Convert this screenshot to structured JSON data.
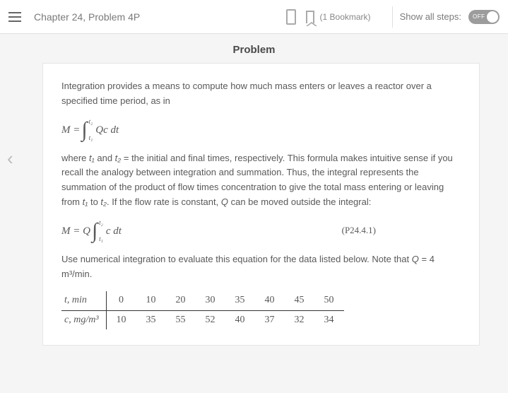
{
  "header": {
    "title": "Chapter 24, Problem 4P",
    "bookmark_text": "(1 Bookmark)",
    "steps_label": "Show all steps:",
    "toggle_state": "OFF"
  },
  "section_heading": "Problem",
  "para1": "Integration provides a means to compute how much mass enters or leaves a reactor over a specified time period, as in",
  "eq1": {
    "lhs": "M =",
    "upper": "t₂",
    "lower": "t₁",
    "body": "Qc dt"
  },
  "para2_a": "where ",
  "para2_t1": "t₁",
  "para2_b": " and ",
  "para2_t2": "t₂",
  "para2_c": " = the initial and final times, respectively. This formula makes intuitive sense if you recall the analogy between integration and summation. Thus, the integral represents the summation of the product of flow times concentration to give the total mass entering or leaving from ",
  "para2_t1b": "t₁",
  "para2_d": " to ",
  "para2_t2b": "t₂",
  "para2_e": ". If the flow rate is constant, ",
  "para2_q": "Q",
  "para2_f": " can be moved outside the integral:",
  "eq2": {
    "lhs": "M = Q",
    "upper": "t₂",
    "lower": "t₁",
    "body": "c dt",
    "label": "(P24.4.1)"
  },
  "para3_a": "Use numerical integration to evaluate this equation for the data listed below. Note that ",
  "para3_q": "Q",
  "para3_b": " = 4 m³/min.",
  "table": {
    "row1_label": "t, min",
    "row2_label": "c, mg/m³",
    "t": [
      "0",
      "10",
      "20",
      "30",
      "35",
      "40",
      "45",
      "50"
    ],
    "c": [
      "10",
      "35",
      "55",
      "52",
      "40",
      "37",
      "32",
      "34"
    ]
  },
  "chart_data": {
    "type": "table",
    "title": "Concentration vs time",
    "columns": [
      "t (min)",
      "c (mg/m^3)"
    ],
    "rows": [
      [
        0,
        10
      ],
      [
        10,
        35
      ],
      [
        20,
        55
      ],
      [
        30,
        52
      ],
      [
        35,
        40
      ],
      [
        40,
        37
      ],
      [
        45,
        32
      ],
      [
        50,
        34
      ]
    ],
    "Q": 4,
    "Q_units": "m^3/min"
  }
}
